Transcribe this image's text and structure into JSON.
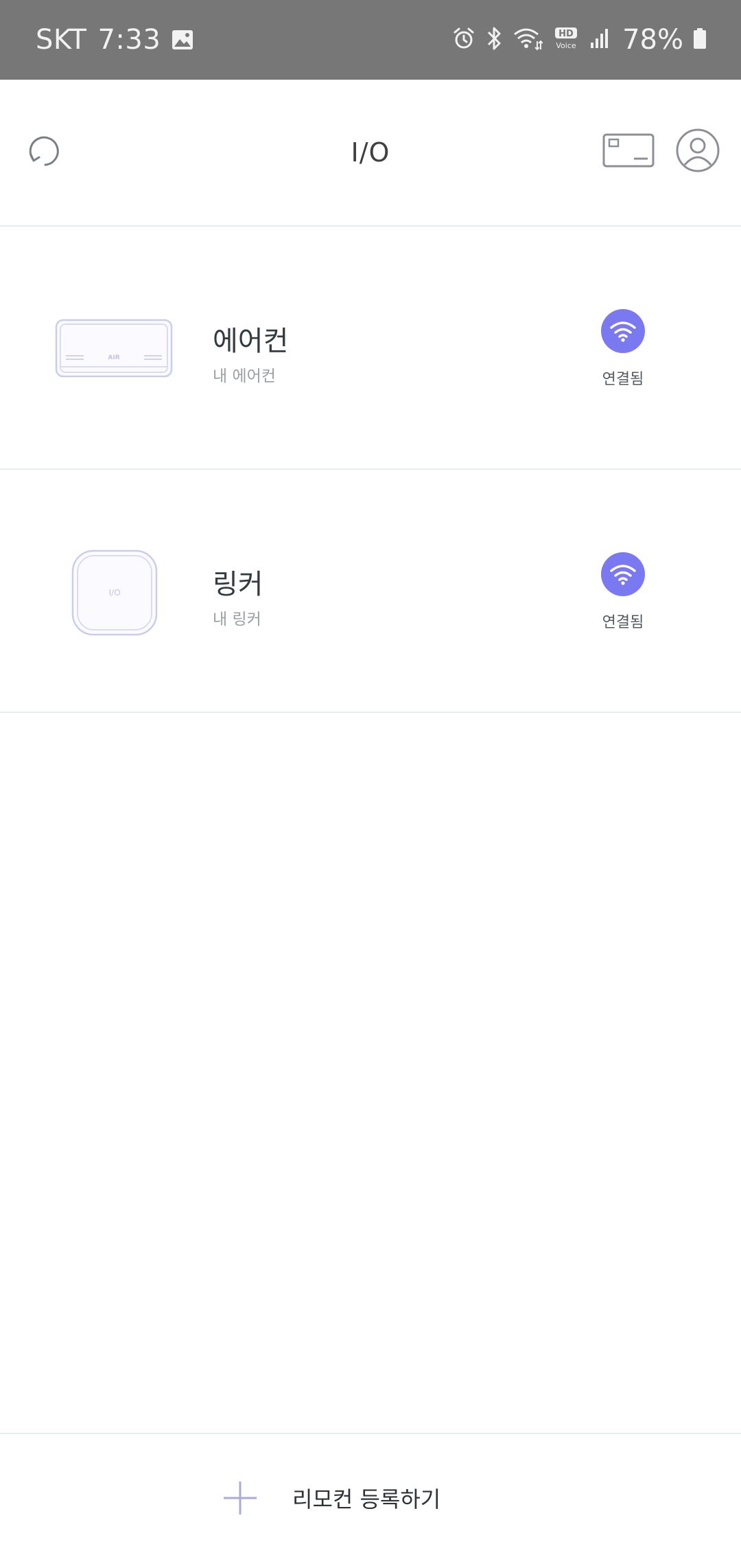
{
  "status_bar": {
    "carrier": "SKT",
    "time": "7:33",
    "battery_pct": "78%",
    "hd_top": "HD",
    "hd_bottom": "Voice",
    "icons": [
      "gallery-icon",
      "alarm-icon",
      "bluetooth-icon",
      "wifi-icon",
      "hd-voice-icon",
      "signal-icon",
      "battery-icon"
    ]
  },
  "header": {
    "title": "I/O",
    "icons": [
      "refresh-icon",
      "card-icon",
      "profile-icon"
    ]
  },
  "devices": [
    {
      "name": "에어컨",
      "subtitle": "내 에어컨",
      "status": "연결됨",
      "thumb_label": "AIR",
      "icon": "air-conditioner-icon"
    },
    {
      "name": "링커",
      "subtitle": "내 링커",
      "status": "연결됨",
      "thumb_label": "I/O",
      "icon": "linker-icon"
    }
  ],
  "footer": {
    "register_label": "리모컨 등록하기",
    "icon": "plus-icon"
  },
  "colors": {
    "status_bar_bg": "#777777",
    "accent": "#7b79f1",
    "divider": "#e6eef0",
    "thumb_outline": "#c9cdee"
  }
}
